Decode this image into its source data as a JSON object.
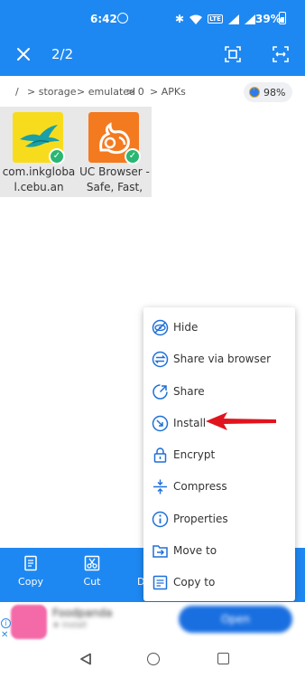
{
  "status_bar": {
    "time": "6:42",
    "lte_label": "LTE",
    "battery_pct": "39%"
  },
  "toolbar": {
    "selection_count": "2/2"
  },
  "breadcrumb": {
    "items": [
      "/",
      "> storage",
      "> emulated",
      "> 0",
      "> APKs"
    ],
    "storage_pct": "98%"
  },
  "files": [
    {
      "name": "com.inkglobal.cebu.an",
      "icon": "cebu-pacific-app-icon",
      "selected": true
    },
    {
      "name": "UC Browser -Safe, Fast,",
      "icon": "uc-browser-app-icon",
      "selected": true
    }
  ],
  "action_bar": {
    "copy_label": "Copy",
    "cut_label": "Cut",
    "third_label": "D"
  },
  "context_menu": {
    "items": [
      {
        "label": "Hide",
        "icon": "eye-off-icon"
      },
      {
        "label": "Share via browser",
        "icon": "transfer-icon"
      },
      {
        "label": "Share",
        "icon": "share-icon"
      },
      {
        "label": "Install",
        "icon": "install-icon"
      },
      {
        "label": "Encrypt",
        "icon": "lock-icon"
      },
      {
        "label": "Compress",
        "icon": "compress-icon"
      },
      {
        "label": "Properties",
        "icon": "info-icon"
      },
      {
        "label": "Move to",
        "icon": "move-icon"
      },
      {
        "label": "Copy to",
        "icon": "copy-to-icon"
      }
    ]
  },
  "ad": {
    "title": "Foodpanda",
    "subtitle": "★ Install",
    "cta": "Open",
    "info_glyph": "i",
    "close_glyph": "✕"
  },
  "colors": {
    "accent": "#1e88f2",
    "menu_icon": "#1e6fd9",
    "arrow": "#e0141e",
    "check": "#2bb673"
  }
}
